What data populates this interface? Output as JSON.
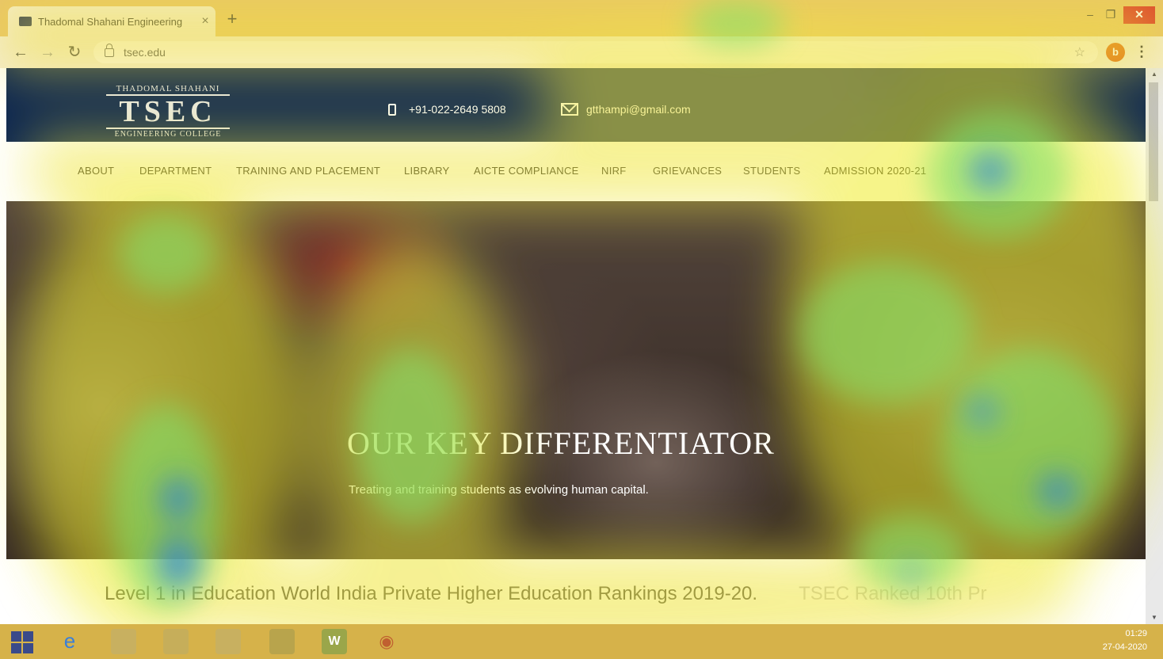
{
  "browser": {
    "tab_title": "Thadomal Shahani Engineering",
    "tab_close": "×",
    "new_tab": "+",
    "url": "tsec.edu",
    "profile_initial": "b",
    "window": {
      "minimize": "–",
      "restore": "❐",
      "close": "✕"
    }
  },
  "header": {
    "logo": {
      "top": "THADOMAL SHAHANI",
      "main": "TSEC",
      "bottom": "ENGINEERING COLLEGE"
    },
    "phone": "+91-022-2649 5808",
    "email": "gtthampi@gmail.com"
  },
  "nav": {
    "items": [
      "ABOUT",
      "DEPARTMENT",
      "TRAINING AND PLACEMENT",
      "LIBRARY",
      "AICTE COMPLIANCE",
      "NIRF",
      "GRIEVANCES",
      "STUDENTS",
      "ADMISSION 2020-21"
    ]
  },
  "hero": {
    "title": "OUR KEY DIFFERENTIATOR",
    "subtitle": "Treating and training students as evolving human capital."
  },
  "ticker": {
    "text": "Level 1 in Education World India Private Higher Education Rankings 2019-20.",
    "next": "TSEC Ranked 10th Pr"
  },
  "taskbar": {
    "time": "01:29",
    "date": "27-04-2020"
  },
  "colors": {
    "header_bg": "#0b2550",
    "heatmap_hot": "#f4f02a",
    "heatmap_mid": "#7fe06a",
    "heatmap_cold": "#2f7fd8"
  }
}
